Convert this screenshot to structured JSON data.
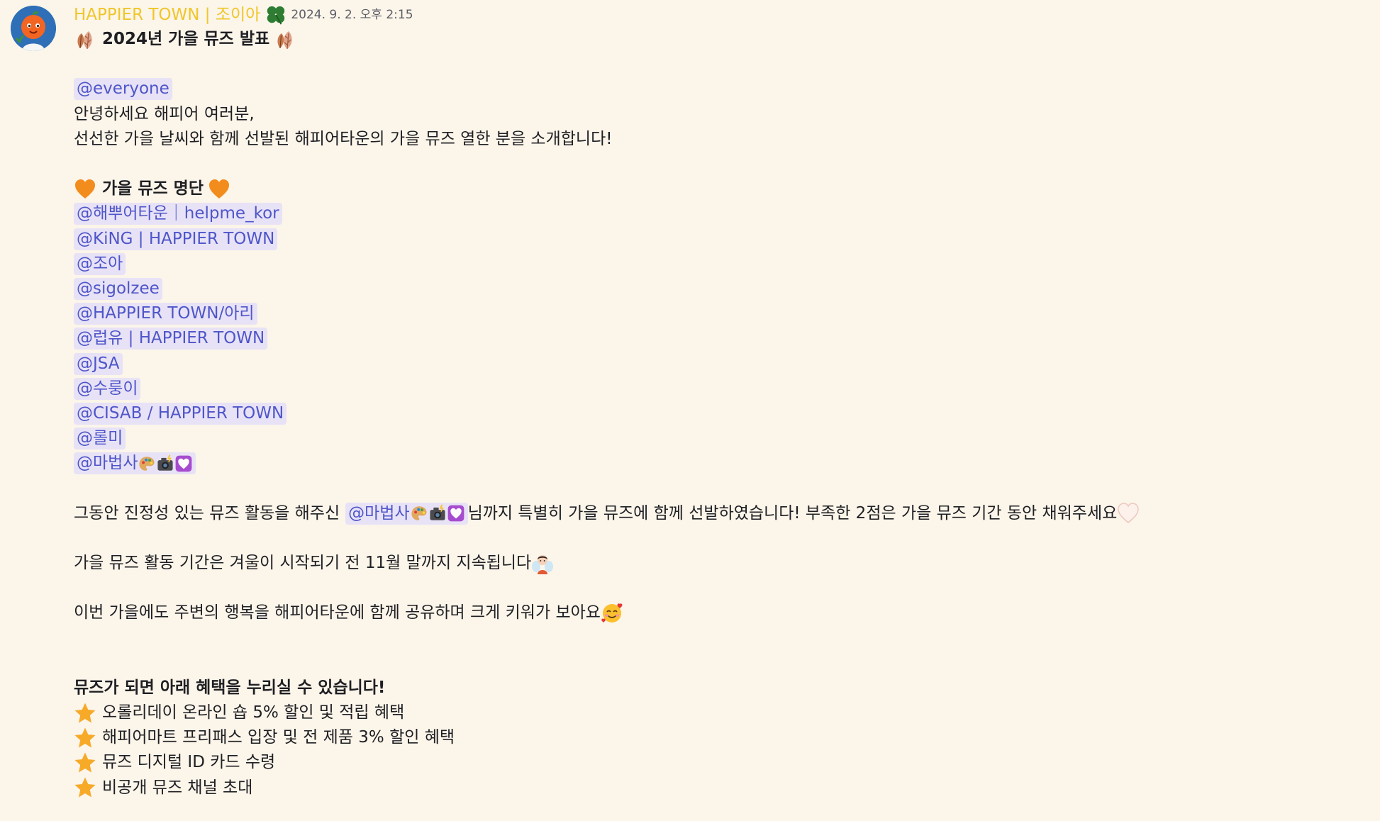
{
  "author": "HAPPIER TOWN | 조이아",
  "timestamp": "2024. 9. 2. 오후 2:15",
  "title": "2024년 가을 뮤즈 발표",
  "everyone_mention": "@everyone",
  "greeting": "안녕하세요 해피어 여러분,",
  "intro": "선선한 가을 날씨와 함께 선발된 해피어타운의 가을 뮤즈 열한 분을 소개합니다!",
  "list_heading": "가을 뮤즈 명단",
  "muses": [
    "@해뿌어타운｜helpme_kor",
    "@KiNG | HAPPIER TOWN",
    "@조아",
    "@sigolzee",
    "@HAPPIER TOWN/아리",
    "@럽유 | HAPPIER TOWN",
    "@JSA",
    "@수룽이",
    "@CISAB / HAPPIER TOWN",
    "@롤미",
    "@마법사"
  ],
  "special_note": {
    "before": "그동안 진정성 있는 뮤즈 활동을 해주신",
    "mention": "@마법사",
    "after": "님까지 특별히 가을 뮤즈에 함께 선발하였습니다! 부족한 2점은 가을 뮤즈 기간 동안 채워주세요"
  },
  "period_note": "가을 뮤즈 활동 기간은 겨울이 시작되기 전 11월 말까지 지속됩니다",
  "closing_note": "이번 가을에도 주변의 행복을 해피어타운에 함께 공유하며 크게 키워가 보아요",
  "benefits_heading": "뮤즈가 되면 아래 혜택을 누리실 수 있습니다!",
  "benefits": [
    "오롤리데이 온라인 숍 5% 할인 및 적립 혜택",
    "해피어마트 프리패스 입장 및 전 제품 3% 할인 혜택",
    "뮤즈 디지털 ID 카드 수령",
    "비공개 뮤즈 채널 초대"
  ],
  "icons": {
    "avatar": "orange-character-avatar",
    "role_badge": "four-leaf-clover-icon",
    "title_decor": "autumn-leaves-icon",
    "heading_decor": "orange-heart-icon",
    "mention_decor": [
      "artist-palette-icon",
      "camera-flash-icon",
      "heart-box-icon"
    ],
    "fairy": "fairy-icon",
    "smile": "smiling-face-with-hearts-icon",
    "heart": "white-heart-icon",
    "bullet": "star-icon"
  },
  "colors": {
    "background": "#fbf5ea",
    "author": "#f0c62a",
    "mention_bg": "#e8e2f6",
    "mention_text": "#4e56c9",
    "text": "#1f1f23",
    "timestamp": "#5c5e66"
  }
}
